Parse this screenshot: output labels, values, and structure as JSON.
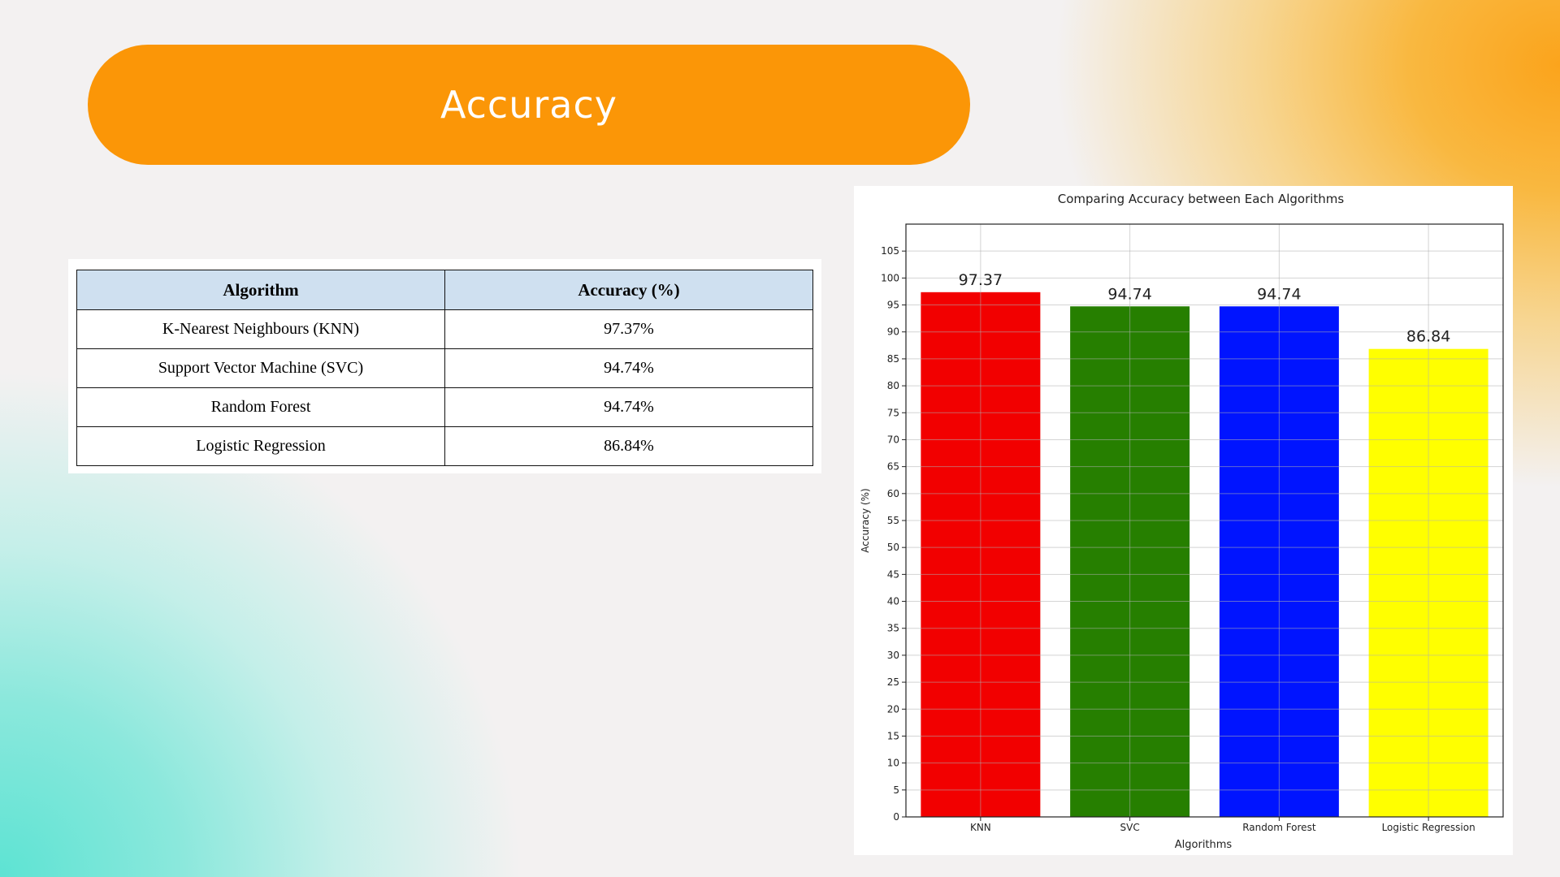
{
  "slide": {
    "title": "Accuracy"
  },
  "table": {
    "headers": [
      "Algorithm",
      "Accuracy (%)"
    ],
    "rows": [
      {
        "algorithm": "K-Nearest Neighbours (KNN)",
        "accuracy": "97.37%"
      },
      {
        "algorithm": "Support Vector Machine (SVC)",
        "accuracy": "94.74%"
      },
      {
        "algorithm": "Random Forest",
        "accuracy": "94.74%"
      },
      {
        "algorithm": "Logistic Regression",
        "accuracy": "86.84%"
      }
    ]
  },
  "chart_data": {
    "type": "bar",
    "title": "Comparing Accuracy between Each Algorithms",
    "xlabel": "Algorithms",
    "ylabel": "Accuracy (%)",
    "categories": [
      "KNN",
      "SVC",
      "Random Forest",
      "Logistic Regression"
    ],
    "values": [
      97.37,
      94.74,
      94.74,
      86.84
    ],
    "data_labels": [
      "97.37",
      "94.74",
      "94.74",
      "86.84"
    ],
    "colors": [
      "#f20000",
      "#267f00",
      "#0014ff",
      "#ffff00"
    ],
    "ylim": [
      0,
      110
    ],
    "yticks": [
      0,
      5,
      10,
      15,
      20,
      25,
      30,
      35,
      40,
      45,
      50,
      55,
      60,
      65,
      70,
      75,
      80,
      85,
      90,
      95,
      100,
      105
    ],
    "grid": true
  },
  "colors": {
    "title_pill": "#fb9607",
    "table_header": "#cfe0f0"
  }
}
